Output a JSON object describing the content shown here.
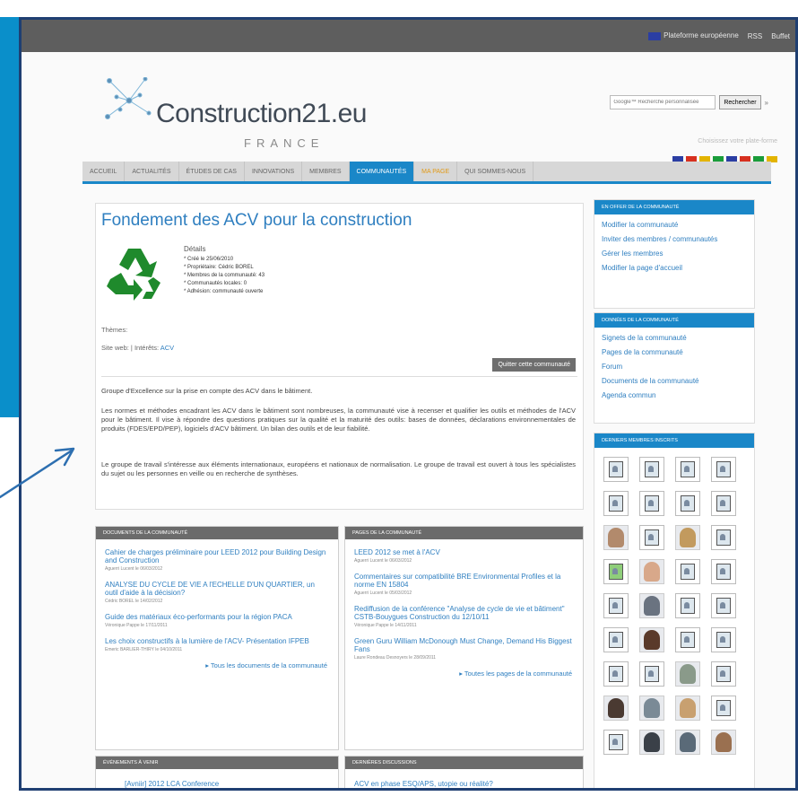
{
  "topbar": {
    "links": [
      "Plateforme européenne",
      "RSS",
      "Buffet"
    ]
  },
  "logo": {
    "name": "Construction21.eu",
    "country": "FRANCE"
  },
  "search": {
    "placeholder": "Google™ Recherche personnalisée",
    "button": "Rechercher"
  },
  "choose_platform": "Choisissez votre plate-forme",
  "flag_colors": [
    "#2b3ea3",
    "#d7301f",
    "#e3b400",
    "#1a9c3a",
    "#2b3ea3",
    "#d7301f",
    "#1a9c3a",
    "#e3b400"
  ],
  "nav": {
    "items": [
      "ACCUEIL",
      "ACTUALITÉS",
      "ÉTUDES DE CAS",
      "INNOVATIONS",
      "MEMBRES",
      "COMMUNAUTÉS",
      "MA PAGE",
      "QUI SOMMES-NOUS"
    ],
    "active": "COMMUNAUTÉS"
  },
  "community": {
    "title": "Fondement des ACV pour la construction",
    "details_label": "Détails",
    "details": [
      "* Créé le 25/06/2010",
      "* Propriétaire: Cédric BOREL",
      "* Membres de la communauté: 43",
      "* Communautés locales: 0",
      "* Adhésion: communauté ouverte"
    ],
    "themes_label": "Thèmes:",
    "site_text": "Site web: | Intérêts:",
    "site_link": "ACV",
    "quit_button": "Quitter cette communauté",
    "desc1": "Groupe d'Excellence sur la prise en compte des ACV dans le bâtiment.",
    "desc2": "Les normes et méthodes encadrant les ACV dans le bâtiment sont nombreuses, la communauté vise à recenser et qualifier les outils et méthodes de l'ACV pour le bâtiment. Il vise à répondre des questions pratiques sur la qualité et la maturité des outils: bases de données, déclarations environnementales de produits (FDES/EPD/PEP), logiciels d'ACV bâtiment. Un bilan des outils et de leur fiabilité.",
    "desc3": "Le groupe de travail s'intéresse aux éléments internationaux, européens et nationaux de normalisation. Le groupe de travail est ouvert à tous les spécialistes du sujet ou les personnes en veille ou en recherche de synthèses."
  },
  "documents": {
    "header": "DOCUMENTS DE LA COMMUNAUTÉ",
    "items": [
      {
        "title": "Cahier de charges préliminaire pour LEED 2012 pour Building Design and Construction",
        "meta": "Aguerri Lucent le 06/03/2012"
      },
      {
        "title": "ANALYSE DU CYCLE DE VIE A l'ECHELLE D'UN QUARTIER, un outil d'aide à la décision?",
        "meta": "Cédric BOREL le 14/02/2012"
      },
      {
        "title": "Guide des matériaux éco-performants pour la région PACA",
        "meta": "Véronique Pappe le 17/11/2011"
      },
      {
        "title": "Les choix constructifs à la lumière de l'ACV- Présentation IFPEB",
        "meta": "Emeric BARLIER-THIRY le 04/10/2011"
      }
    ],
    "all_link": "▸ Tous les documents de la communauté"
  },
  "pages": {
    "header": "PAGES DE LA COMMUNAUTÉ",
    "items": [
      {
        "title": "LEED 2012 se met à l'ACV",
        "meta": "Aguerri Lucent le 06/03/2012"
      },
      {
        "title": "Commentaires sur compatibilité BRE Environmental Profiles et la norme EN 15804",
        "meta": "Aguerri Lucent le 05/03/2012"
      },
      {
        "title": "Rediffusion de la conférence \"Analyse de cycle de vie et bâtiment\" CSTB-Bouygues Construction du 12/10/11",
        "meta": "Véronique Pappe le 14/11/2011"
      },
      {
        "title": "Green Guru William McDonough Must Change, Demand His Biggest Fans",
        "meta": "Laure Rondeau Desnoyers le 28/09/2011"
      }
    ],
    "all_link": "▸ Toutes les pages de la communauté"
  },
  "events": {
    "header": "ÉVÉNEMENTS À VENIR",
    "items": [
      {
        "title": "[Avniir] 2012 LCA Conference"
      }
    ]
  },
  "discussions": {
    "header": "DERNIÈRES DISCUSSIONS",
    "items": [
      {
        "title": "ACV en phase ESQ/APS, utopie ou réalité?"
      }
    ]
  },
  "sidebar": {
    "admin": {
      "header": "EN OFFER DE LA COMMUNAUTÉ",
      "links": [
        "Modifier la communauté",
        "Inviter des membres / communautés",
        "Gérer les membres",
        "Modifier la page d'accueil"
      ]
    },
    "data": {
      "header": "DONNÉES DE LA COMMUNAUTÉ",
      "links": [
        "Signets de la communauté",
        "Pages de la communauté",
        "Forum",
        "Documents de la communauté",
        "Agenda commun"
      ]
    },
    "members": {
      "header": "DERNIERS MEMBRES INSCRITS"
    }
  },
  "colors": {
    "accent": "#1a87c8",
    "frame": "#1f3f72",
    "panel": "#0a8fca",
    "link": "#2f7fc0"
  }
}
